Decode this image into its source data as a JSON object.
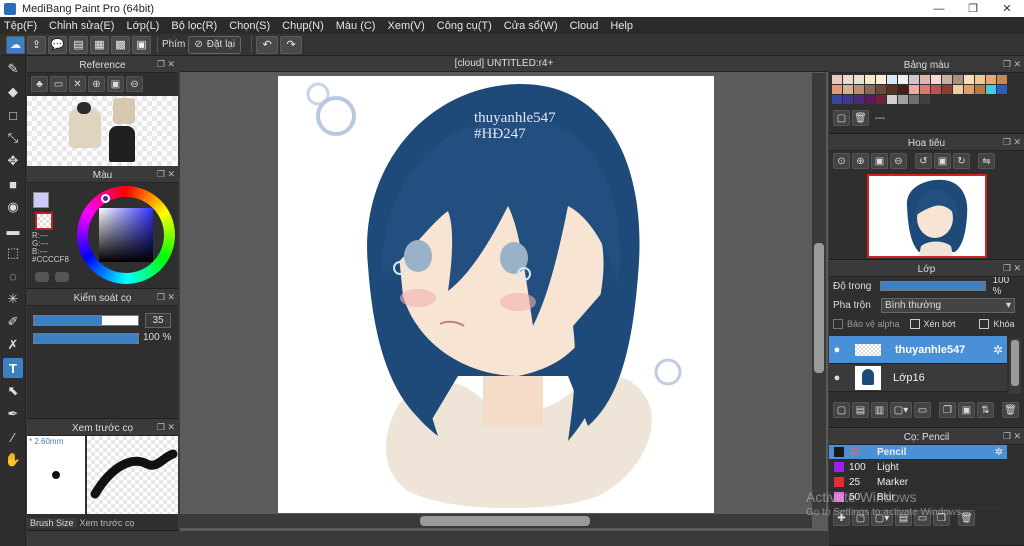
{
  "window": {
    "title": "MediBang Paint Pro (64bit)",
    "minimize": "—",
    "restore": "❐",
    "close": "✕"
  },
  "menu": [
    "Tệp(F)",
    "Chỉnh sửa(E)",
    "Lớp(L)",
    "Bộ lọc(R)",
    "Chọn(S)",
    "Chụp(N)",
    "Màu (C)",
    "Xem(V)",
    "Công cụ(T)",
    "Cửa sổ(W)",
    "Cloud",
    "Help"
  ],
  "toolbar": {
    "filter_label": "Phím",
    "reset_label": "Đặt lại"
  },
  "canvas": {
    "tab_title": "[cloud] UNTITLED:r4+",
    "watermark_name": "thuyanhle547",
    "watermark_tag": "#HĐ247"
  },
  "reference": {
    "title": "Reference"
  },
  "color_panel": {
    "title": "Màu",
    "r": "R:---",
    "g": "G:---",
    "b": "B:---",
    "hex": "#CCCCF8"
  },
  "brush_control": {
    "title": "Kiểm soát cọ",
    "size_value": "35",
    "opacity_value": "100 %"
  },
  "brush_preview": {
    "title": "Xem trước cọ",
    "size_label": "* 2.60mm",
    "tab_size": "Brush Size",
    "tab_preview": "Xem trước cọ"
  },
  "palette": {
    "title": "Bảng màu",
    "name": "---",
    "colors": [
      "#e8c8c0",
      "#f0d8c8",
      "#e8e0d0",
      "#f8e8c8",
      "#f8f0d8",
      "#d8e8f0",
      "#f0f0f0",
      "#d0c8c8",
      "#e0b8a8",
      "#f8d8d0",
      "#c8b0a0",
      "#a89080",
      "#f8e0b0",
      "#f0c890",
      "#e8a870",
      "#c88850",
      "#e89878",
      "#d8b098",
      "#b89078",
      "#886858",
      "#704838",
      "#583020",
      "#402018",
      "#f0a8a0",
      "#e07870",
      "#c05050",
      "#903838",
      "#f8c8a0",
      "#e0a068",
      "#b87840",
      "#48c8e8",
      "#2860c0",
      "#3848a0",
      "#403890",
      "#502878",
      "#601858",
      "#702040",
      "#d0d0d0",
      "#a0a0a0",
      "#707070",
      "#404040"
    ]
  },
  "navigator": {
    "title": "Hoa tiêu"
  },
  "layers": {
    "title": "Lớp",
    "opacity_label": "Độ trong",
    "opacity_value": "100 %",
    "blend_label": "Pha trộn",
    "blend_value": "Bình thường",
    "protect_alpha": "Bảo vệ alpha",
    "clipping": "Xén bớt",
    "lock": "Khóa",
    "items": [
      {
        "name": "thuyanhle547",
        "selected": true
      },
      {
        "name": "Lớp16",
        "selected": false
      }
    ]
  },
  "brushes": {
    "title": "Cọ: Pencil",
    "items": [
      {
        "size": "35",
        "name": "Pencil",
        "color": "#1a1a1a",
        "selected": true
      },
      {
        "size": "100",
        "name": "Light",
        "color": "#a020f0",
        "selected": false
      },
      {
        "size": "25",
        "name": "Marker",
        "color": "#e03030",
        "selected": false
      },
      {
        "size": "50",
        "name": "Blur",
        "color": "#e070e0",
        "selected": false
      }
    ]
  },
  "os_watermark": {
    "line1": "Activate Windows",
    "line2": "Go to Settings to activate Windows."
  }
}
